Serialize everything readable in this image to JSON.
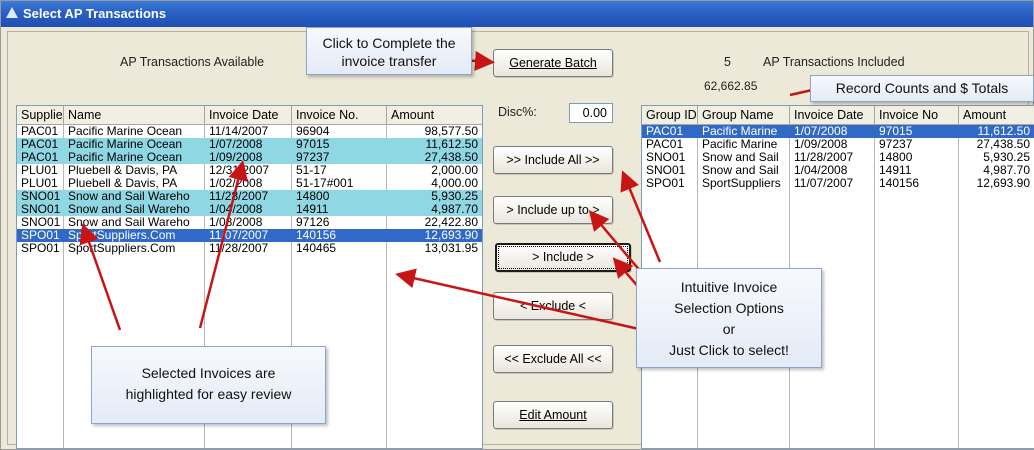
{
  "window": {
    "title": "Select AP Transactions"
  },
  "left_panel": {
    "caption": "AP Transactions Available",
    "columns": [
      "Supplier ID",
      "Name",
      "Invoice Date",
      "Invoice No.",
      "Amount"
    ],
    "rows": [
      {
        "supplier": "PAC01",
        "name": "Pacific Marine Ocean",
        "date": "11/14/2007",
        "invoice": "96904",
        "amount": "98,577.50",
        "state": "normal"
      },
      {
        "supplier": "PAC01",
        "name": "Pacific Marine Ocean",
        "date": "1/07/2008",
        "invoice": "97015",
        "amount": "11,612.50",
        "state": "highlighted"
      },
      {
        "supplier": "PAC01",
        "name": "Pacific Marine Ocean",
        "date": "1/09/2008",
        "invoice": "97237",
        "amount": "27,438.50",
        "state": "highlighted"
      },
      {
        "supplier": "PLU01",
        "name": "Pluebell & Davis, PA",
        "date": "12/31/2007",
        "invoice": "51-17",
        "amount": "2,000.00",
        "state": "normal"
      },
      {
        "supplier": "PLU01",
        "name": "Pluebell & Davis, PA",
        "date": "1/02/2008",
        "invoice": "51-17#001",
        "amount": "4,000.00",
        "state": "normal"
      },
      {
        "supplier": "SNO01",
        "name": "Snow and Sail Wareho",
        "date": "11/28/2007",
        "invoice": "14800",
        "amount": "5,930.25",
        "state": "highlighted"
      },
      {
        "supplier": "SNO01",
        "name": "Snow and Sail Wareho",
        "date": "1/04/2008",
        "invoice": "14911",
        "amount": "4,987.70",
        "state": "highlighted"
      },
      {
        "supplier": "SNO01",
        "name": "Snow and Sail Wareho",
        "date": "1/08/2008",
        "invoice": "97126",
        "amount": "22,422.80",
        "state": "normal"
      },
      {
        "supplier": "SPO01",
        "name": "SportSuppliers.Com",
        "date": "11/07/2007",
        "invoice": "140156",
        "amount": "12,693.90",
        "state": "selected"
      },
      {
        "supplier": "SPO01",
        "name": "SportSuppliers.Com",
        "date": "11/28/2007",
        "invoice": "140465",
        "amount": "13,031.95",
        "state": "normal"
      }
    ]
  },
  "middle": {
    "generate_batch": "Generate Batch",
    "disc_label": "Disc%:",
    "disc_value": "0.00",
    "include_all": ">> Include All >>",
    "include_up_to": "> Include up to >",
    "include": "> Include >",
    "exclude": "< Exclude <",
    "exclude_all": "<< Exclude All <<",
    "edit_amount": "Edit Amount"
  },
  "right_panel": {
    "count": "5",
    "caption": "AP Transactions Included",
    "total": "62,662.85",
    "columns": [
      "Group ID",
      "Group Name",
      "Invoice Date",
      "Invoice No",
      "Amount"
    ],
    "rows": [
      {
        "group": "PAC01",
        "name": "Pacific Marine",
        "date": "1/07/2008",
        "invoice": "97015",
        "amount": "11,612.50",
        "state": "selected"
      },
      {
        "group": "PAC01",
        "name": "Pacific Marine",
        "date": "1/09/2008",
        "invoice": "97237",
        "amount": "27,438.50",
        "state": "normal"
      },
      {
        "group": "SNO01",
        "name": "Snow and Sail",
        "date": "11/28/2007",
        "invoice": "14800",
        "amount": "5,930.25",
        "state": "normal"
      },
      {
        "group": "SNO01",
        "name": "Snow and Sail",
        "date": "1/04/2008",
        "invoice": "14911",
        "amount": "4,987.70",
        "state": "normal"
      },
      {
        "group": "SPO01",
        "name": "SportSuppliers",
        "date": "11/07/2007",
        "invoice": "140156",
        "amount": "12,693.90",
        "state": "normal"
      }
    ]
  },
  "callouts": {
    "complete": [
      "Click to Complete the",
      "invoice transfer"
    ],
    "record_counts": "Record Counts and $ Totals",
    "options": [
      "Intuitive Invoice",
      "Selection Options",
      "or",
      "Just Click to select!"
    ],
    "selected": [
      "Selected Invoices are",
      "highlighted for easy review"
    ]
  },
  "colors": {
    "highlight": "#8fd8e3",
    "selection": "#3169c6",
    "arrow": "#c81414"
  }
}
